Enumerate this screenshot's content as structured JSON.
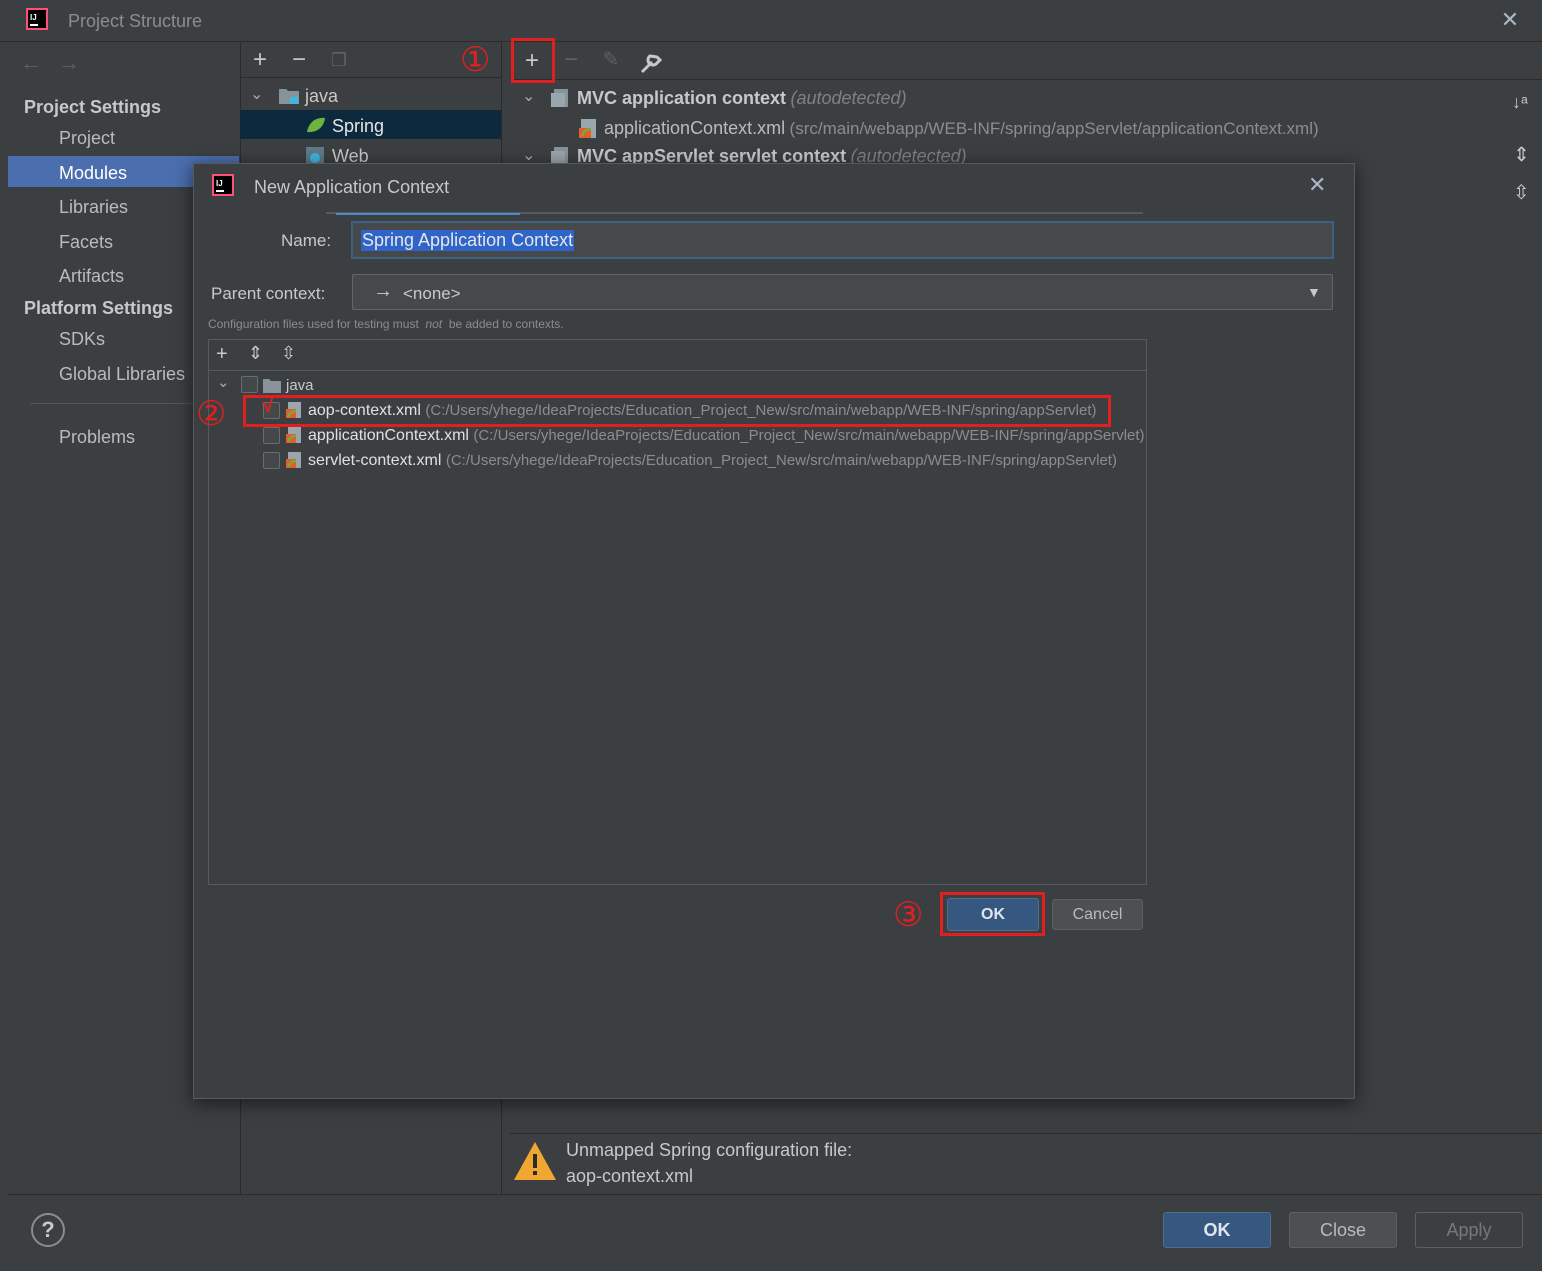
{
  "window": {
    "title": "Project Structure"
  },
  "nav": {
    "project_settings_header": "Project Settings",
    "project_settings_items": [
      "Project",
      "Modules",
      "Libraries",
      "Facets",
      "Artifacts"
    ],
    "platform_settings_header": "Platform Settings",
    "platform_settings_items": [
      "SDKs",
      "Global Libraries"
    ],
    "problems": "Problems",
    "selected": "Modules"
  },
  "module_tree": {
    "root": "java",
    "children": [
      "Spring",
      "Web"
    ],
    "selected": "Spring"
  },
  "contexts": {
    "items": [
      {
        "name": "MVC application context",
        "note": "(autodetected)",
        "file": "applicationContext.xml",
        "path": "(src/main/webapp/WEB-INF/spring/appServlet/applicationContext.xml)"
      },
      {
        "name": "MVC appServlet servlet context",
        "note": "(autodetected)"
      }
    ]
  },
  "warning": {
    "line1": "Unmapped Spring configuration file:",
    "line2": "aop-context.xml"
  },
  "annotations": {
    "step1": "①",
    "step2": "②",
    "step3": "③"
  },
  "dialog": {
    "title": "New Application Context",
    "name_label": "Name:",
    "name_value": "Spring Application Context",
    "parent_label": "Parent context:",
    "parent_value": "<none>",
    "hint_prefix": "Configuration files used for testing must",
    "hint_not": "not",
    "hint_suffix": "be added to contexts.",
    "tree_root": "java",
    "files": [
      {
        "name": "aop-context.xml",
        "path": "(C:/Users/yhege/IdeaProjects/Education_Project_New/src/main/webapp/WEB-INF/spring/appServlet)",
        "checked": true
      },
      {
        "name": "applicationContext.xml",
        "path": "(C:/Users/yhege/IdeaProjects/Education_Project_New/src/main/webapp/WEB-INF/spring/appServlet)",
        "checked": false
      },
      {
        "name": "servlet-context.xml",
        "path": "(C:/Users/yhege/IdeaProjects/Education_Project_New/src/main/webapp/WEB-INF/spring/appServlet)",
        "checked": false
      }
    ],
    "ok_label": "OK",
    "cancel_label": "Cancel"
  },
  "footer": {
    "help_label": "?",
    "ok_label": "OK",
    "close_label": "Close",
    "apply_label": "Apply"
  },
  "colors": {
    "background": "#3c3f41",
    "selection": "#4b6eaf",
    "annotation_red": "#e21f1f",
    "primary_button": "#365880"
  }
}
